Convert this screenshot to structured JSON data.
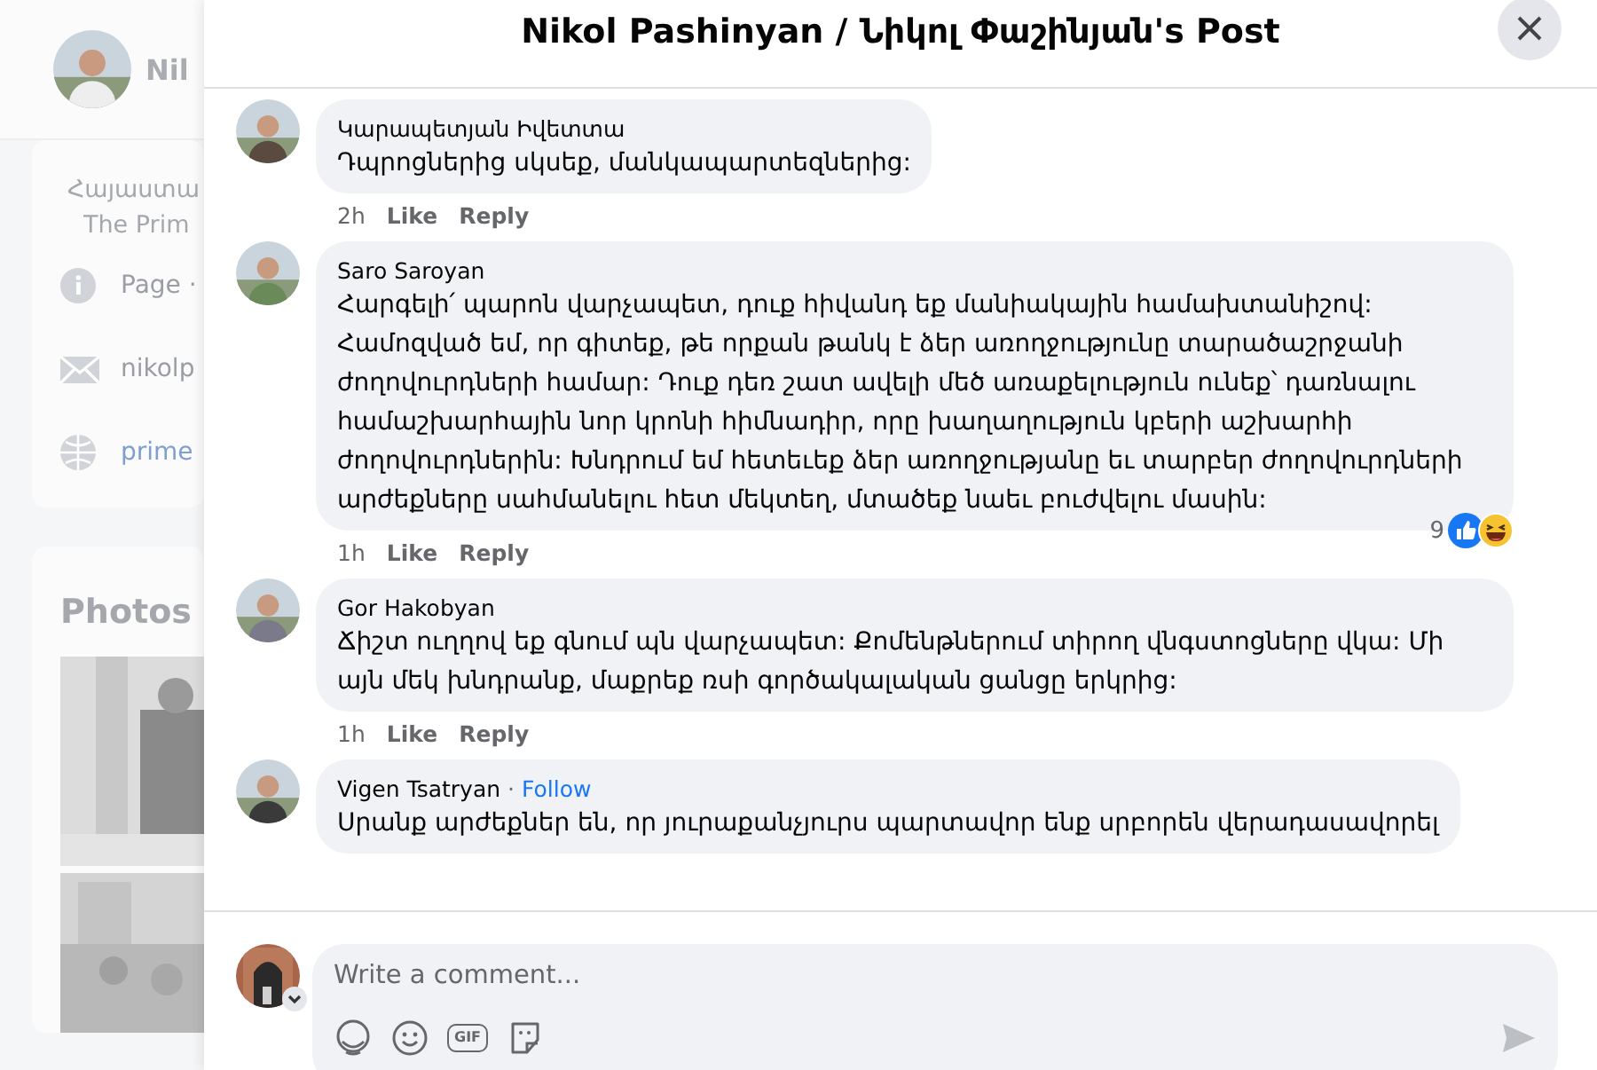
{
  "background": {
    "page_name": "Nil",
    "about": [
      "Հայաստա",
      "The Prim"
    ],
    "info": [
      {
        "kind": "info",
        "text": "Page ·"
      },
      {
        "kind": "email",
        "text": "nikolp"
      },
      {
        "kind": "web",
        "text": "prime"
      }
    ],
    "photos_title": "Photos"
  },
  "dialog": {
    "title": "Nikol Pashinyan / Նիկոլ Փաշինյան's Post",
    "comments": [
      {
        "author": "Կարապետյան Իվետտա",
        "text": "Դպրոցներից սկսեք, մանկապարտեզներից:",
        "time": "2h",
        "like": "Like",
        "reply": "Reply"
      },
      {
        "author": "Saro Saroyan",
        "text": "Հարգելի՛ պարոն վարչապետ, դուք հիվանդ եք մանիակային համախտանիշով: Համոզված եմ, որ գիտեք, թե որքան թանկ է ձեր առողջությունը տարածաշրջանի ժողովուրդների համար: Դուք դեռ շատ ավելի մեծ առաքելություն ունեք՝ դառնալու համաշխարհային նոր կրոնի հիմնադիր, որը խաղաղություն կբերի աշխարհի ժողովուրդներին: Խնդրում եմ հետեւեք ձեր առողջությանը եւ տարբեր ժողովուրդների արժեքները սահմանելու հետ մեկտեղ, մտածեք նաեւ բուժվելու մասին:",
        "time": "1h",
        "like": "Like",
        "reply": "Reply",
        "reactions": "9"
      },
      {
        "author": "Gor Hakobyan",
        "text": "Ճիշտ ուղղով եք գնում պն վարչապետ: Քոմենթներում տիրող վնգստոցները վկա: Մի այն մեկ խնդրանք, մաքրեք ռսի գործակալական ցանցը երկրից:",
        "time": "1h",
        "like": "Like",
        "reply": "Reply"
      },
      {
        "author": "Vigen Tsatryan",
        "separator": "·",
        "follow": "Follow",
        "text": "Սրանք արժեքներ են, որ յուրաքանչյուրս պարտավոր ենք սրբորեն վերադասավորել"
      }
    ],
    "composer": {
      "placeholder": "Write a comment...",
      "gif": "GIF"
    }
  }
}
